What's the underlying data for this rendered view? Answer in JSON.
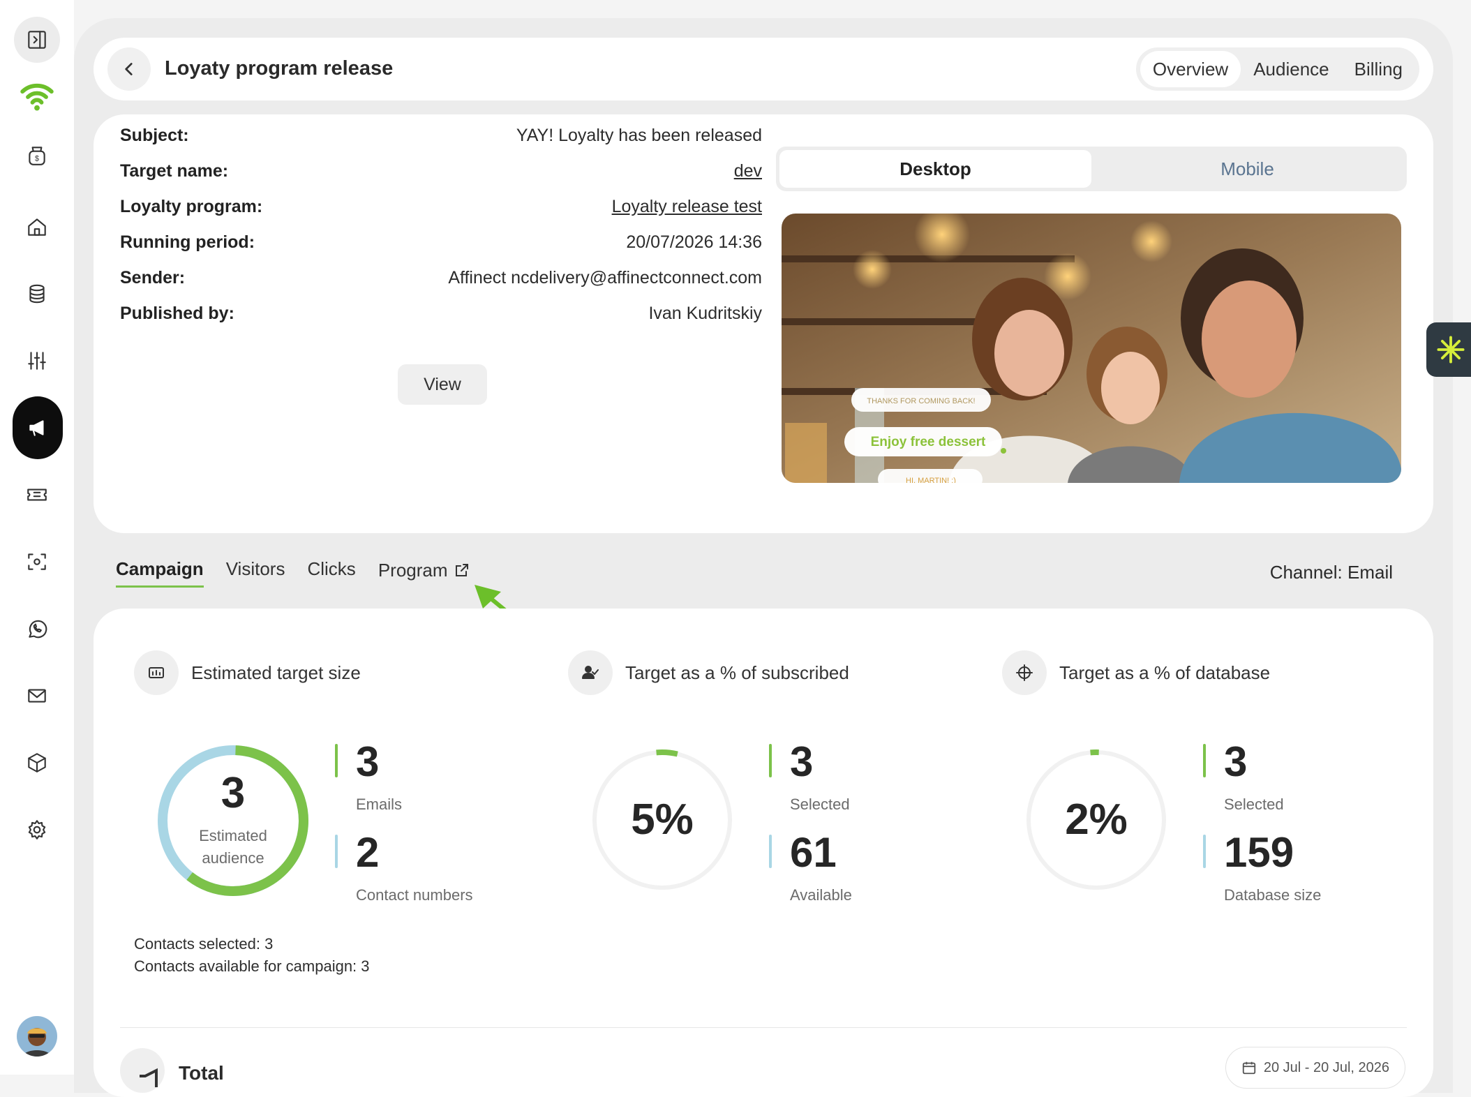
{
  "header": {
    "title": "Loyaty program release",
    "tabs": [
      "Overview",
      "Audience",
      "Billing"
    ],
    "active_tab": "Overview"
  },
  "details": {
    "rows": [
      {
        "key": "Subject:",
        "value": "YAY! Loyalty has been released"
      },
      {
        "key": "Target name:",
        "value": "dev"
      },
      {
        "key": "Loyalty program:",
        "value": "Loyalty release test"
      },
      {
        "key": "Running period:",
        "value": "20/07/2026 14:36"
      },
      {
        "key": "Sender:",
        "value": "Affinect ncdelivery@affinectconnect.com"
      },
      {
        "key": "Published by:",
        "value": "Ivan Kudritskiy"
      }
    ],
    "view_label": "View"
  },
  "preview": {
    "tabs": [
      "Desktop",
      "Mobile"
    ],
    "active": "Desktop",
    "bubble_top": "THANKS FOR COMING BACK!",
    "bubble_main": "Enjoy free dessert",
    "bubble_bottom": "HI, MARTIN! :)"
  },
  "subtabs": {
    "items": [
      "Campaign",
      "Visitors",
      "Clicks",
      "Program"
    ],
    "active": "Campaign",
    "channel": "Channel: Email"
  },
  "stats": {
    "estimated": {
      "title": "Estimated target size",
      "center_value": "3",
      "center_label": "Estimated audience",
      "metric1_value": "3",
      "metric1_label": "Emails",
      "metric2_value": "2",
      "metric2_label": "Contact numbers",
      "emails_fraction": 0.6,
      "contacts_selected": "Contacts selected: 3",
      "contacts_available": "Contacts available for campaign: 3"
    },
    "subscribed": {
      "title": "Target as a % of subscribed",
      "percent": "5%",
      "fraction": 0.05,
      "metric1_value": "3",
      "metric1_label": "Selected",
      "metric2_value": "61",
      "metric2_label": "Available"
    },
    "database": {
      "title": "Target as a % of database",
      "percent": "2%",
      "fraction": 0.02,
      "metric1_value": "3",
      "metric1_label": "Selected",
      "metric2_value": "159",
      "metric2_label": "Database size"
    }
  },
  "total": {
    "label": "Total",
    "date_range": "20 Jul - 20 Jul, 2026"
  },
  "colors": {
    "accent_green": "#7cc24a",
    "light_blue": "#a9d6e5",
    "dark": "#0d0d0d"
  },
  "icons": [
    "sidebar-toggle-icon",
    "wifi-logo-icon",
    "money-bag-icon",
    "home-icon",
    "database-icon",
    "sliders-icon",
    "megaphone-icon",
    "ticket-icon",
    "scan-icon",
    "whatsapp-icon",
    "mail-icon",
    "box-icon",
    "gear-icon",
    "calendar-icon",
    "external-link-icon"
  ]
}
